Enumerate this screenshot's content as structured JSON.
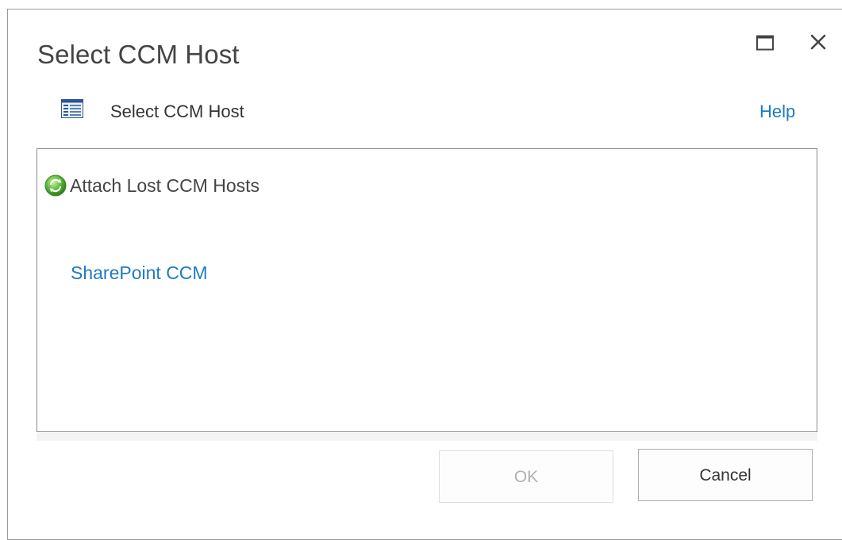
{
  "dialog": {
    "title": "Select CCM Host",
    "maximize_icon": "maximize-icon",
    "close_icon": "close-icon"
  },
  "page_header": {
    "icon": "list-page-icon",
    "label": "Select CCM Host",
    "help_label": "Help"
  },
  "host_list": {
    "attach": {
      "icon": "refresh-globe-icon",
      "label": "Attach Lost CCM Hosts"
    },
    "hosts": [
      {
        "label": "SharePoint CCM"
      }
    ]
  },
  "footer": {
    "ok_label": "OK",
    "ok_enabled": false,
    "cancel_label": "Cancel"
  },
  "colors": {
    "link": "#1e7bc4",
    "title_text": "#444444",
    "disabled_text": "#b0b0b0"
  }
}
